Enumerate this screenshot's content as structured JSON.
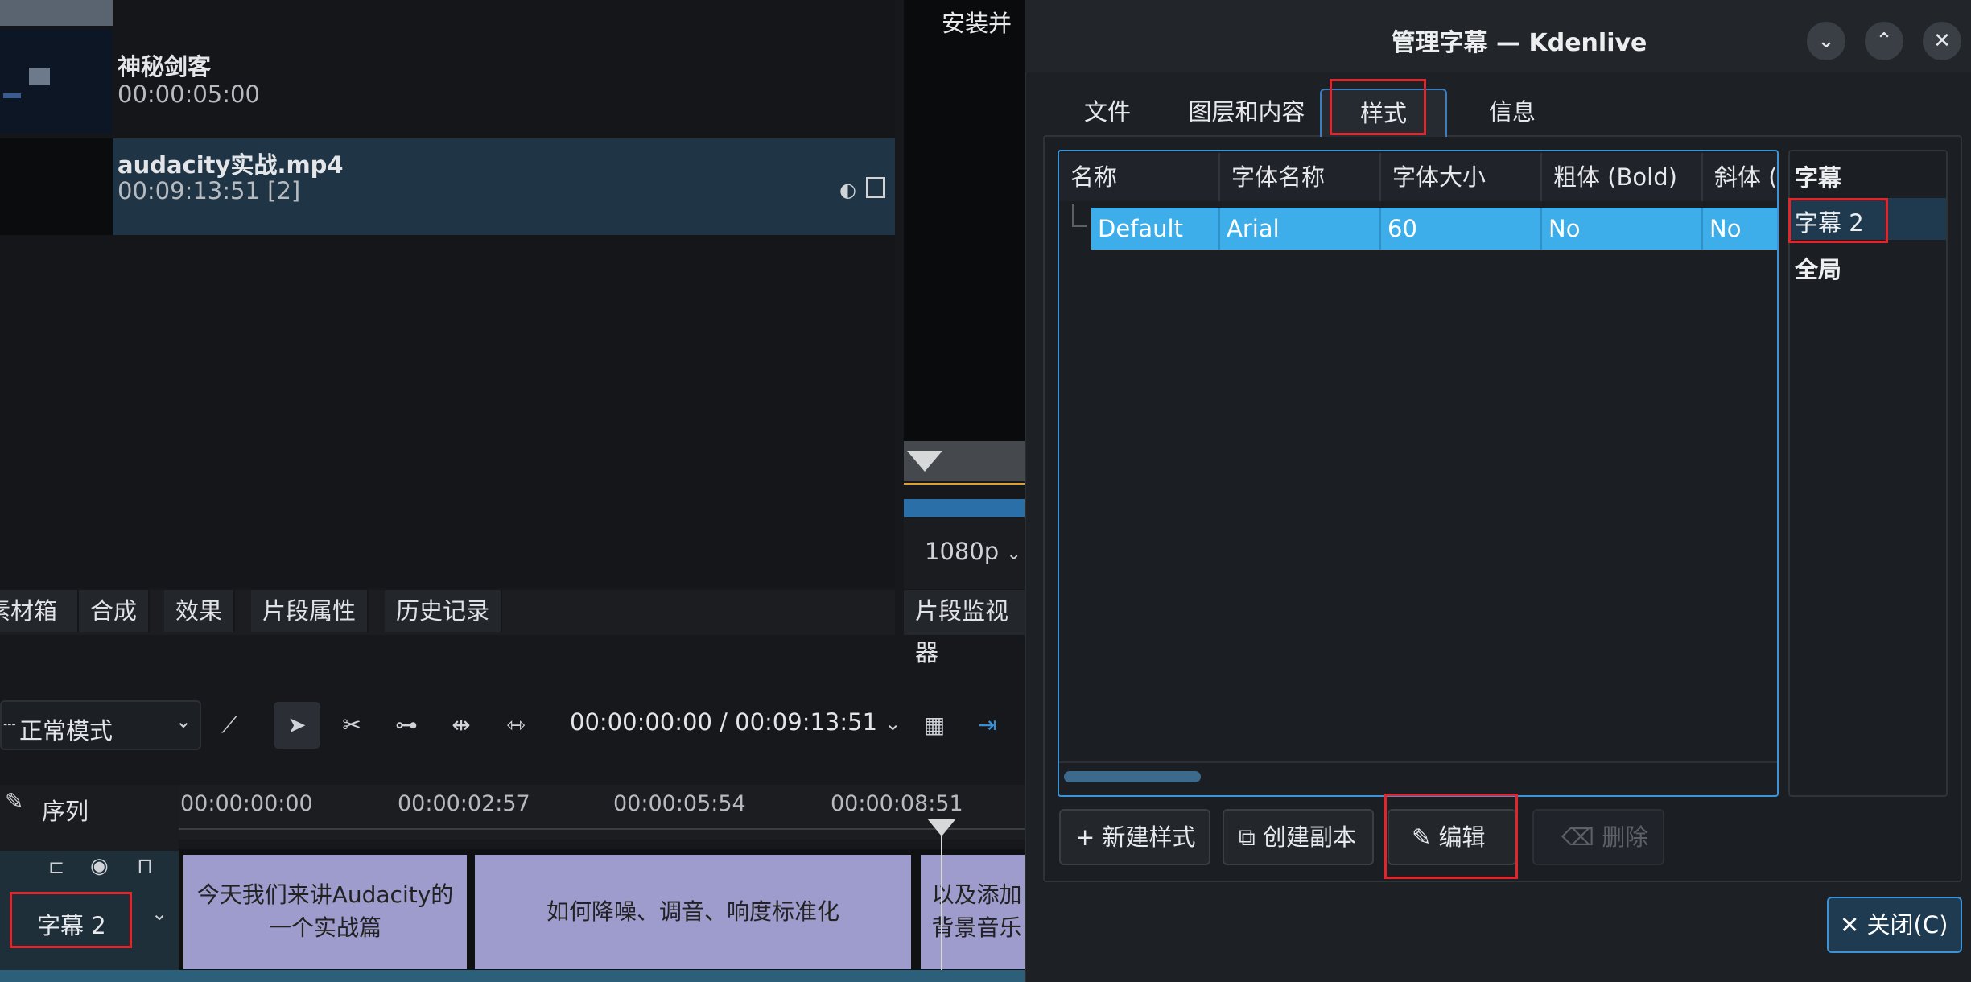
{
  "project_bin": {
    "clip1": {
      "name": "神秘剑客",
      "duration": "00:00:05:00"
    },
    "clip2": {
      "name": "audacity实战.mp4",
      "duration": "00:09:13:51 [2]",
      "icons": [
        "audio-icon",
        "video-icon"
      ]
    },
    "tabs": [
      "素材箱",
      "合成",
      "效果",
      "片段属性",
      "历史记录"
    ]
  },
  "clip_monitor": {
    "overlay_text": "安装并",
    "resolution": "1080p",
    "tab": "片段监视器"
  },
  "timeline": {
    "mode": "正常模式",
    "timecode": "00:00:00:00 / 00:09:13:51",
    "sequence_label": "序列",
    "ruler_marks": [
      "00:00:00:00",
      "00:00:02:57",
      "00:00:05:54",
      "00:00:08:51"
    ],
    "track_name": "字幕 2",
    "subtitle_clips": [
      "今天我们来讲Audacity的一个实战篇",
      "如何降噪、调音、响度标准化",
      "以及添加背景音乐"
    ]
  },
  "dialog": {
    "title": "管理字幕 — Kdenlive",
    "tabs": [
      "文件",
      "图层和内容",
      "样式",
      "信息"
    ],
    "active_tab": "样式",
    "table": {
      "columns": [
        "名称",
        "字体名称",
        "字体大小",
        "粗体 (Bold)",
        "斜体 ("
      ],
      "rows": [
        [
          "Default",
          "Arial",
          "60",
          "No",
          "No"
        ]
      ]
    },
    "side_list": [
      "字幕",
      "字幕 2",
      "全局"
    ],
    "side_selected": "字幕 2",
    "buttons": {
      "new_style": "新建样式",
      "duplicate": "创建副本",
      "edit": "编辑",
      "delete": "删除",
      "close": "关闭(C)"
    },
    "accent": "#3daee9",
    "highlight": "#e0262b"
  }
}
